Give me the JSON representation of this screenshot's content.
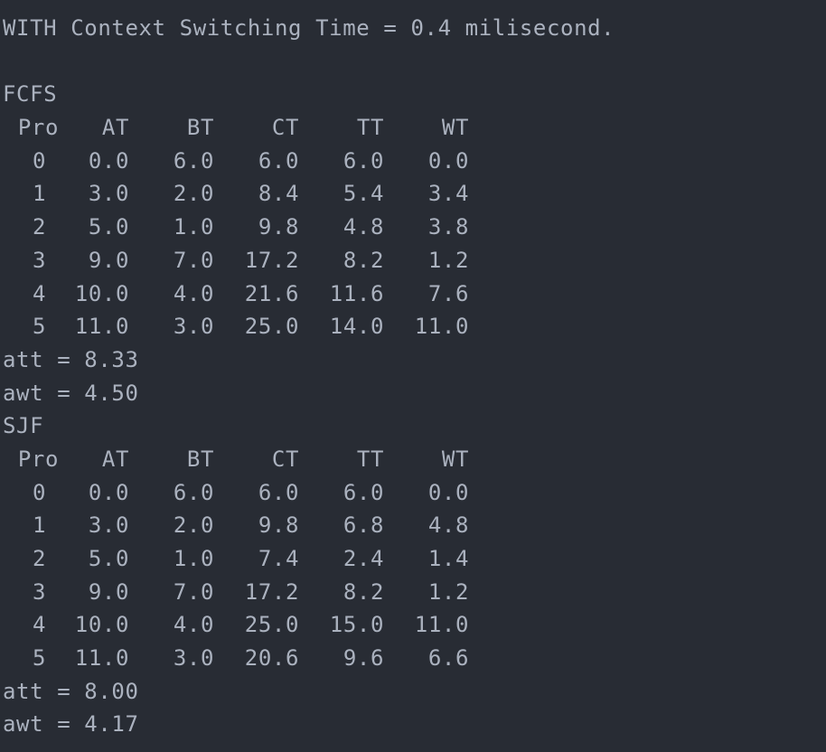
{
  "header": "WITH Context Switching Time = 0.4 milisecond.",
  "columns": [
    "Pro",
    "AT",
    "BT",
    "CT",
    "TT",
    "WT"
  ],
  "fcfs": {
    "title": "FCFS",
    "rows": [
      [
        "0",
        "0.0",
        "6.0",
        "6.0",
        "6.0",
        "0.0"
      ],
      [
        "1",
        "3.0",
        "2.0",
        "8.4",
        "5.4",
        "3.4"
      ],
      [
        "2",
        "5.0",
        "1.0",
        "9.8",
        "4.8",
        "3.8"
      ],
      [
        "3",
        "9.0",
        "7.0",
        "17.2",
        "8.2",
        "1.2"
      ],
      [
        "4",
        "10.0",
        "4.0",
        "21.6",
        "11.6",
        "7.6"
      ],
      [
        "5",
        "11.0",
        "3.0",
        "25.0",
        "14.0",
        "11.0"
      ]
    ],
    "att": "att = 8.33",
    "awt": "awt = 4.50"
  },
  "sjf": {
    "title": "SJF",
    "rows": [
      [
        "0",
        "0.0",
        "6.0",
        "6.0",
        "6.0",
        "0.0"
      ],
      [
        "1",
        "3.0",
        "2.0",
        "9.8",
        "6.8",
        "4.8"
      ],
      [
        "2",
        "5.0",
        "1.0",
        "7.4",
        "2.4",
        "1.4"
      ],
      [
        "3",
        "9.0",
        "7.0",
        "17.2",
        "8.2",
        "1.2"
      ],
      [
        "4",
        "10.0",
        "4.0",
        "25.0",
        "15.0",
        "11.0"
      ],
      [
        "5",
        "11.0",
        "3.0",
        "20.6",
        "9.6",
        "6.6"
      ]
    ],
    "att": "att = 8.00",
    "awt": "awt = 4.17"
  }
}
